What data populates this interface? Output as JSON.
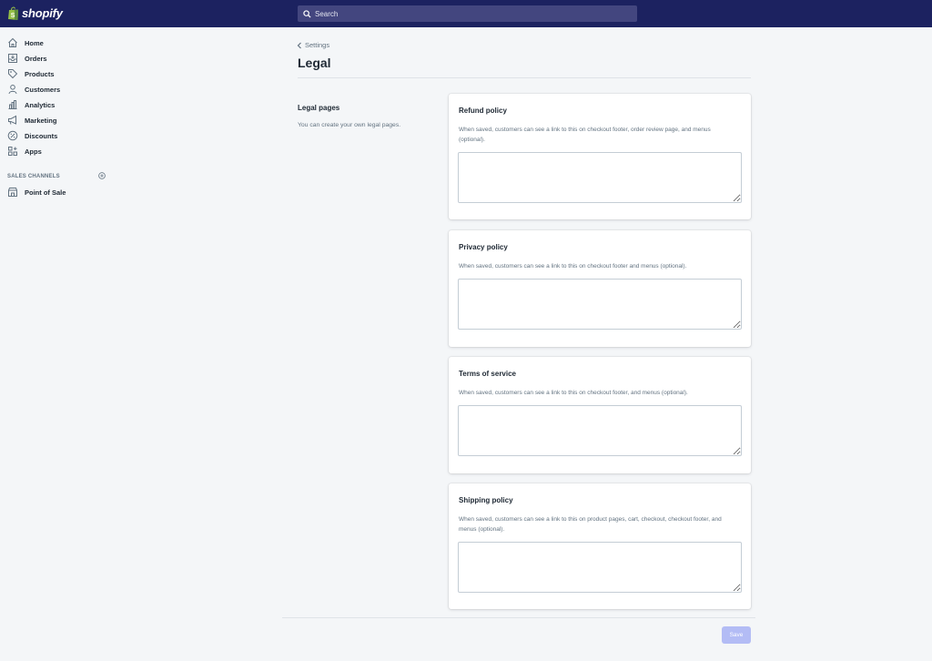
{
  "brand": {
    "name": "shopify",
    "logo_color": "#95bf47"
  },
  "search": {
    "placeholder": "Search"
  },
  "sidebar": {
    "items": [
      {
        "label": "Home",
        "icon": "home-icon"
      },
      {
        "label": "Orders",
        "icon": "orders-icon"
      },
      {
        "label": "Products",
        "icon": "tag-icon"
      },
      {
        "label": "Customers",
        "icon": "person-icon"
      },
      {
        "label": "Analytics",
        "icon": "bar-chart-icon"
      },
      {
        "label": "Marketing",
        "icon": "megaphone-icon"
      },
      {
        "label": "Discounts",
        "icon": "discount-icon"
      },
      {
        "label": "Apps",
        "icon": "apps-icon"
      }
    ],
    "sales_channels_label": "SALES CHANNELS",
    "channels": [
      {
        "label": "Point of Sale",
        "icon": "store-icon"
      }
    ]
  },
  "header": {
    "breadcrumb": "Settings",
    "title": "Legal"
  },
  "section": {
    "heading": "Legal pages",
    "description": "You can create your own legal pages."
  },
  "cards": [
    {
      "title": "Refund policy",
      "help": "When saved, customers can see a link to this on checkout footer, order review page, and menus (optional).",
      "value": ""
    },
    {
      "title": "Privacy policy",
      "help": "When saved, customers can see a link to this on checkout footer and menus (optional).",
      "value": ""
    },
    {
      "title": "Terms of service",
      "help": "When saved, customers can see a link to this on checkout footer, and menus (optional).",
      "value": ""
    },
    {
      "title": "Shipping policy",
      "help": "When saved, customers can see a link to this on product pages, cart, checkout, checkout footer, and menus (optional).",
      "value": ""
    }
  ],
  "footer": {
    "save_label": "Save"
  },
  "colors": {
    "topbar": "#1c2260",
    "primary_disabled": "#b3bcf5"
  }
}
